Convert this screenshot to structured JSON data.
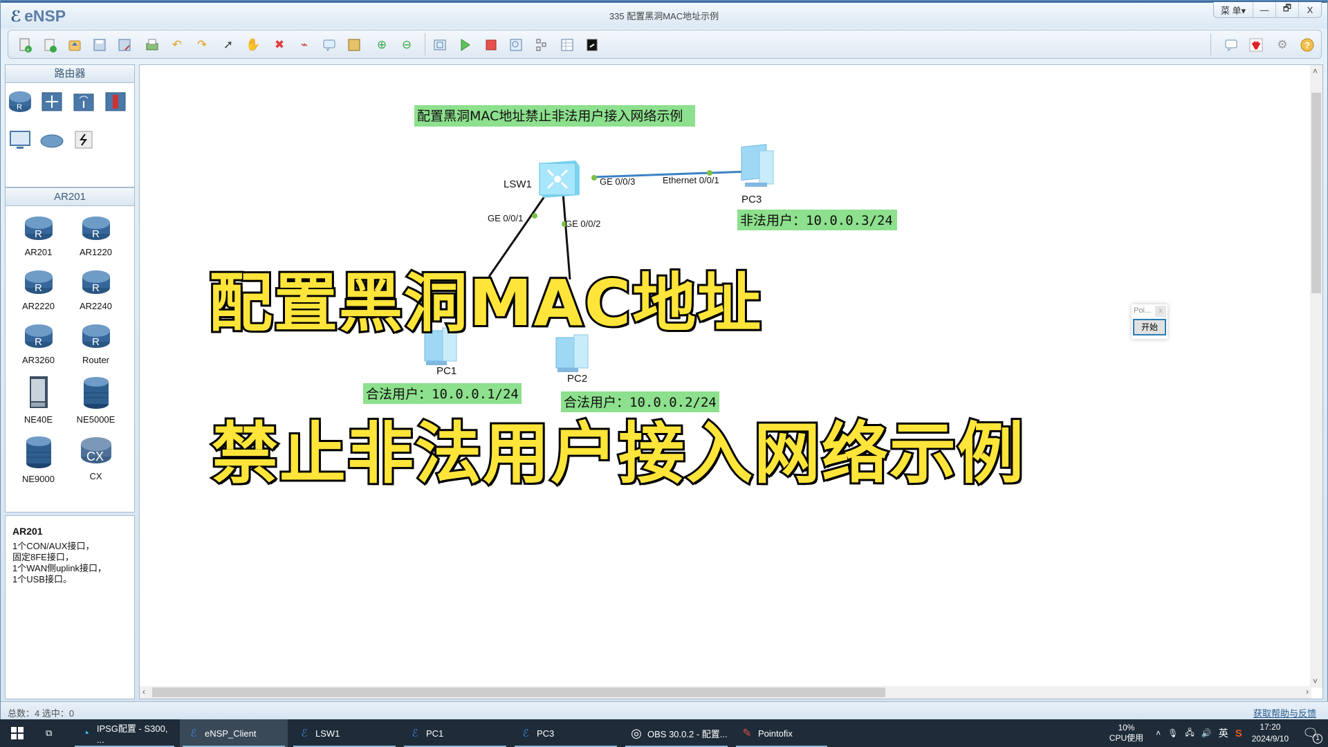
{
  "app": {
    "logo_text": "eNSP",
    "window_title": "335 配置黑洞MAC地址示例",
    "menu_label": "菜 单▾",
    "minimize_label": "—",
    "restore_label": "🗗",
    "close_label": "X"
  },
  "toolbar": {
    "left_icons": [
      "new-topology-icon",
      "new-lab-icon",
      "open-icon",
      "save-icon",
      "save-as-icon",
      "print-icon",
      "undo-icon",
      "redo-icon",
      "select-pointer-icon",
      "pan-hand-icon",
      "delete-icon",
      "delete-link-icon",
      "text-annotation-icon",
      "palette-icon",
      "zoom-in-icon",
      "zoom-out-icon",
      "fit-view-icon",
      "start-device-icon",
      "stop-device-icon",
      "capture-icon",
      "topology-icon",
      "grid-icon",
      "console-icon"
    ],
    "right_icons": [
      "message-icon",
      "huawei-icon",
      "settings-icon",
      "help-icon"
    ]
  },
  "left_panel": {
    "category_header": "路由器",
    "category_icons": [
      "router-category-icon",
      "switch-category-icon",
      "wireless-category-icon",
      "firewall-category-icon",
      "pc-category-icon",
      "cloud-category-icon",
      "connection-category-icon"
    ],
    "device_header": "AR201",
    "devices": [
      {
        "label": "AR201",
        "icon": "router-icon"
      },
      {
        "label": "AR1220",
        "icon": "router-icon"
      },
      {
        "label": "AR2220",
        "icon": "router-icon"
      },
      {
        "label": "AR2240",
        "icon": "router-icon"
      },
      {
        "label": "AR3260",
        "icon": "router-icon"
      },
      {
        "label": "Router",
        "icon": "router-icon"
      },
      {
        "label": "NE40E",
        "icon": "chassis-icon"
      },
      {
        "label": "NE5000E",
        "icon": "core-router-icon"
      },
      {
        "label": "NE9000",
        "icon": "core-router-icon"
      },
      {
        "label": "CX",
        "icon": "cx-router-icon"
      }
    ],
    "info": {
      "title": "AR201",
      "lines": [
        "1个CON/AUX接口，",
        "固定8FE接口，",
        "1个WAN侧uplink接口，",
        "1个USB接口。"
      ]
    }
  },
  "canvas": {
    "title_label": "配置黑洞MAC地址禁止非法用户接入网络示例",
    "nodes": [
      {
        "name": "LSW1",
        "type": "switch"
      },
      {
        "name": "PC1",
        "type": "pc"
      },
      {
        "name": "PC2",
        "type": "pc"
      },
      {
        "name": "PC3",
        "type": "pc"
      }
    ],
    "ports": {
      "lsw1_pc3": "GE 0/0/3",
      "pc3_lsw1": "Ethernet 0/0/1",
      "lsw1_pc1": "GE 0/0/1",
      "lsw1_pc2": "GE 0/0/2"
    },
    "labels": {
      "pc1": "合法用户：10.0.0.1/24",
      "pc2": "合法用户：10.0.0.2/24",
      "pc3": "非法用户：10.0.0.3/24"
    },
    "overlay_line1": "配置黑洞MAC地址",
    "overlay_line2": "禁止非法用户接入网络示例"
  },
  "pointofix": {
    "title": "Poi...",
    "close": "x",
    "start_label": "开始"
  },
  "ime": {
    "logo": "S",
    "lang": "英",
    "punct": "•,",
    "items": [
      "mic-icon",
      "keyboard-icon",
      "skin-icon",
      "game-icon",
      "apps-icon",
      "avatar-icon"
    ]
  },
  "statusbar": {
    "left": "总数：4  选中：0",
    "right_link": "获取帮助与反馈"
  },
  "taskbar": {
    "tasks": [
      {
        "label": "IPSG配置 - S300, ...",
        "icon": "edge-icon",
        "active": false
      },
      {
        "label": "eNSP_Client",
        "icon": "ensp-icon",
        "active": true
      },
      {
        "label": "LSW1",
        "icon": "ensp-icon",
        "active": false
      },
      {
        "label": "PC1",
        "icon": "ensp-icon",
        "active": false
      },
      {
        "label": "PC3",
        "icon": "ensp-icon",
        "active": false
      },
      {
        "label": "OBS 30.0.2 - 配置...",
        "icon": "obs-icon",
        "active": false
      },
      {
        "label": "Pointofix",
        "icon": "pointofix-icon",
        "active": false
      }
    ],
    "cpu_percent": "10%",
    "cpu_label": "CPU使用",
    "ime_lang": "英",
    "time": "17:20",
    "date": "2024/9/10",
    "notification_count": "1"
  }
}
